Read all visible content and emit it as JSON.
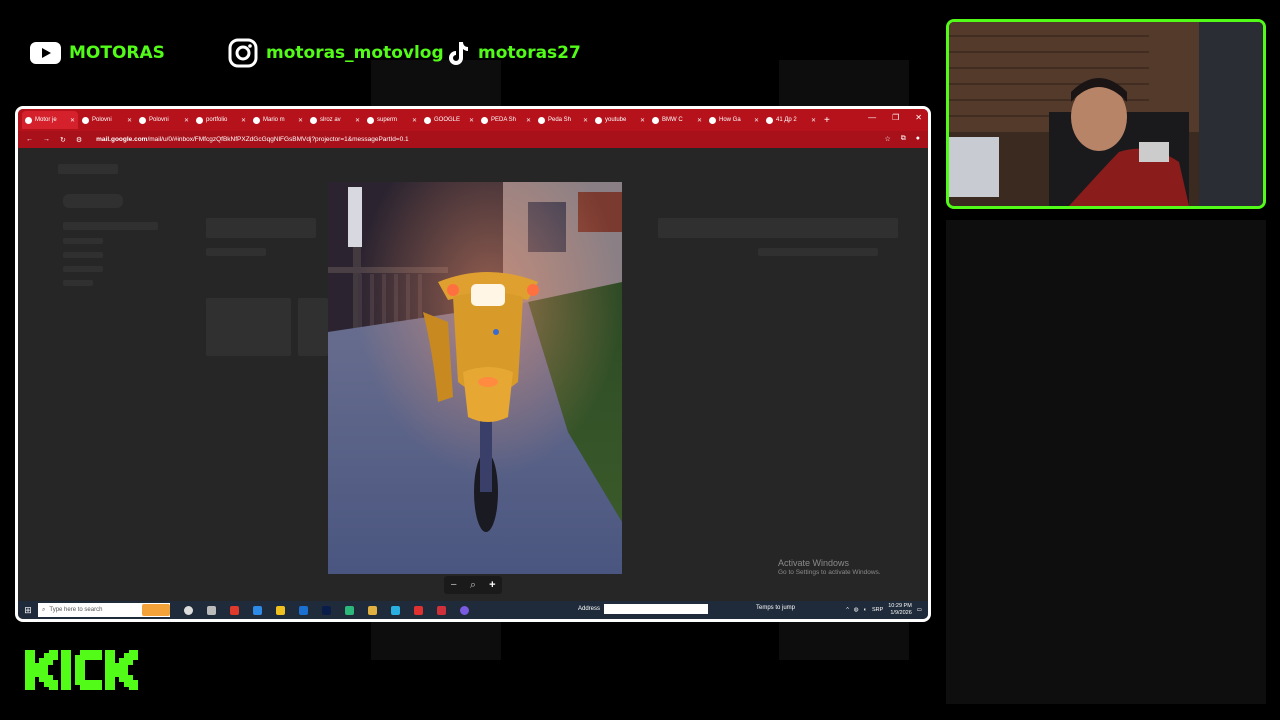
{
  "socials": {
    "youtube": {
      "label": "MOTORAS",
      "icon": "youtube-icon"
    },
    "instagram": {
      "label": "motoras_motovlog",
      "icon": "instagram-icon"
    },
    "tiktok": {
      "label": "motoras27",
      "icon": "tiktok-icon"
    }
  },
  "browser": {
    "tabs": [
      {
        "label": "Motor je",
        "active": true
      },
      {
        "label": "Polovni"
      },
      {
        "label": "Polovni"
      },
      {
        "label": "portfolio"
      },
      {
        "label": "Mario m"
      },
      {
        "label": "slroz av"
      },
      {
        "label": "superm"
      },
      {
        "label": "GOOGLE"
      },
      {
        "label": "PEDA Sh"
      },
      {
        "label": "Peda Sh"
      },
      {
        "label": "youtube"
      },
      {
        "label": "BMW C"
      },
      {
        "label": "How Ga"
      },
      {
        "label": "41 Др 2"
      }
    ],
    "url_host": "mail.google.com",
    "url_path": "/mail/u/0/#inbox/FMfcgzQfBkNfPXZdGcGqgNlFGsBMVdj?projector=1&messagePartId=0.1"
  },
  "viewer": {
    "zoom_out": "−",
    "zoom_reset": "⌕",
    "zoom_in": "+"
  },
  "watermark": {
    "title": "Activate Windows",
    "subtitle": "Go to Settings to activate Windows."
  },
  "taskbar": {
    "search_placeholder": "Type here to search",
    "address_label": "Address",
    "weather": "Temps to jump",
    "lang": "SRP",
    "time": "10:29 PM",
    "date": "1/9/2026"
  },
  "brand": {
    "logo": "KICK",
    "color": "#53fc18"
  },
  "colors": {
    "accent": "#53fc18",
    "tabbar": "#b5121b"
  }
}
